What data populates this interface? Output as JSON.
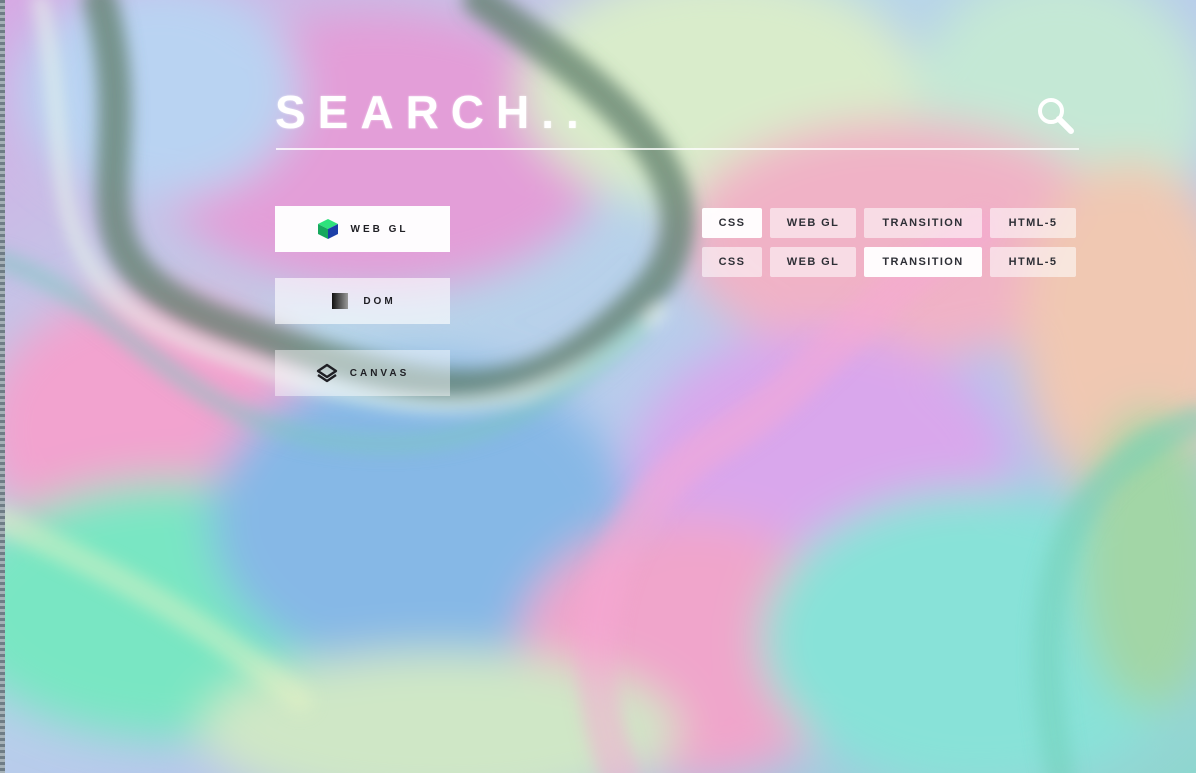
{
  "search": {
    "label": "SEARCH..",
    "icon": "search-icon"
  },
  "categories": [
    {
      "label": "WEB GL",
      "icon": "cube-icon"
    },
    {
      "label": "DOM",
      "icon": "gradient-square-icon"
    },
    {
      "label": "CANVAS",
      "icon": "layers-icon"
    }
  ],
  "tags": {
    "row1": [
      "CSS",
      "WEB GL",
      "TRANSITION",
      "HTML-5"
    ],
    "row2": [
      "CSS",
      "WEB GL",
      "TRANSITION",
      "HTML-5"
    ]
  },
  "colors": {
    "text_light": "#ffffff",
    "text_dark": "#2e2f36",
    "cube_green": "#1fc06a",
    "cube_blue": "#1c3fa8"
  }
}
